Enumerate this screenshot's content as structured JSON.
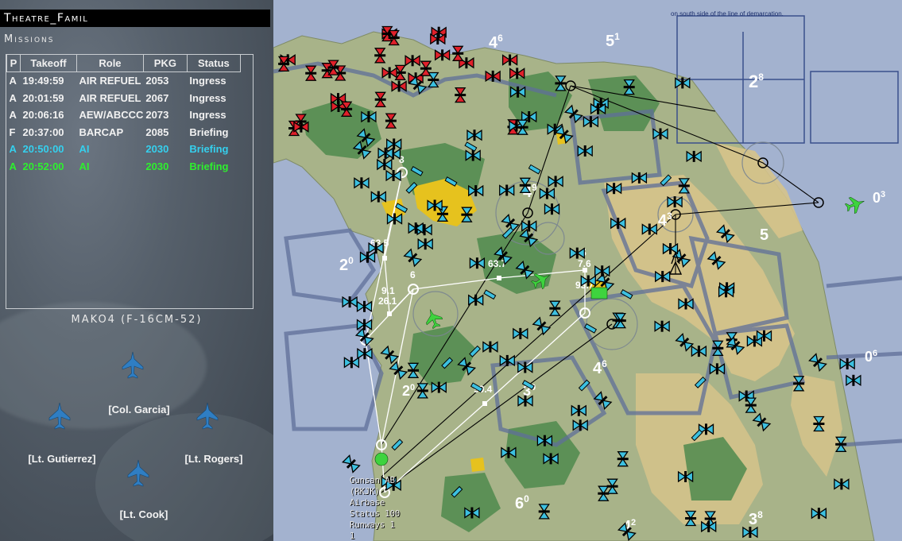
{
  "window": {
    "title": "Theatre_Famil"
  },
  "missions": {
    "title": "Missions",
    "columns": [
      "P",
      "Takeoff",
      "Role",
      "PKG",
      "Status"
    ],
    "rows": [
      {
        "p": "A",
        "takeoff": "19:49:59",
        "role": "AIR REFUEL",
        "pkg": "2053",
        "status": "Ingress",
        "color": "#f2f2f2"
      },
      {
        "p": "A",
        "takeoff": "20:01:59",
        "role": "AIR REFUEL",
        "pkg": "2067",
        "status": "Ingress",
        "color": "#f2f2f2"
      },
      {
        "p": "A",
        "takeoff": "20:06:16",
        "role": "AEW/ABCCC",
        "pkg": "2073",
        "status": "Ingress",
        "color": "#f2f2f2"
      },
      {
        "p": "F",
        "takeoff": "20:37:00",
        "role": "BARCAP",
        "pkg": "2085",
        "status": "Briefing",
        "color": "#f2f2f2"
      },
      {
        "p": "A",
        "takeoff": "20:50:00",
        "role": "AI",
        "pkg": "2030",
        "status": "Briefing",
        "color": "#35d0ee"
      },
      {
        "p": "A",
        "takeoff": "20:52:00",
        "role": "AI",
        "pkg": "2030",
        "status": "Briefing",
        "color": "#2ef02e"
      }
    ]
  },
  "flight": {
    "callsign": "MAKO4 (F-16CM-52)",
    "pilots": [
      "[Col. Garcia]",
      "[Lt. Gutierrez]",
      "[Lt. Rogers]",
      "[Lt. Cook]"
    ]
  },
  "map": {
    "demarcation_note": "on south side of the line of demarcation.",
    "waypoint_labels": [
      "8",
      "63.5",
      "63.7",
      "5",
      "7.6",
      "6",
      "99.4",
      "9.1",
      "26.1",
      "93.7"
    ],
    "grid_labels": [
      {
        "main": "4",
        "sup": "6"
      },
      {
        "main": "5",
        "sup": "1"
      },
      {
        "main": "2",
        "sup": "8"
      },
      {
        "main": "4",
        "sup": "9"
      },
      {
        "main": "0",
        "sup": "3"
      },
      {
        "main": "4",
        "sup": "3"
      },
      {
        "main": "2",
        "sup": "0"
      },
      {
        "main": "4",
        "sup": "6"
      },
      {
        "main": "0",
        "sup": "6"
      },
      {
        "main": "2",
        "sup": "0"
      },
      {
        "main": "3",
        "sup": "9"
      },
      {
        "main": "6",
        "sup": "0"
      },
      {
        "main": "3",
        "sup": "8"
      },
      {
        "main": "4",
        "sup": "2"
      },
      {
        "main": "5",
        "sup": ""
      }
    ],
    "airbase": {
      "name": "Gunsan AB",
      "code": "(RKJK)",
      "type": "Airbase",
      "status": "Status 100",
      "runways": "Runways 1",
      "extra": "1"
    },
    "colors": {
      "sea": "#a3b2cf",
      "land": "#a8b389",
      "sand": "#d6c38b",
      "forest": "#4f8a4e",
      "route_line": "#ffffff",
      "threat_line": "#000000",
      "friendly": "#3cc0e0",
      "enemy": "#e0202a",
      "player_flight": "#3ed33e"
    }
  }
}
